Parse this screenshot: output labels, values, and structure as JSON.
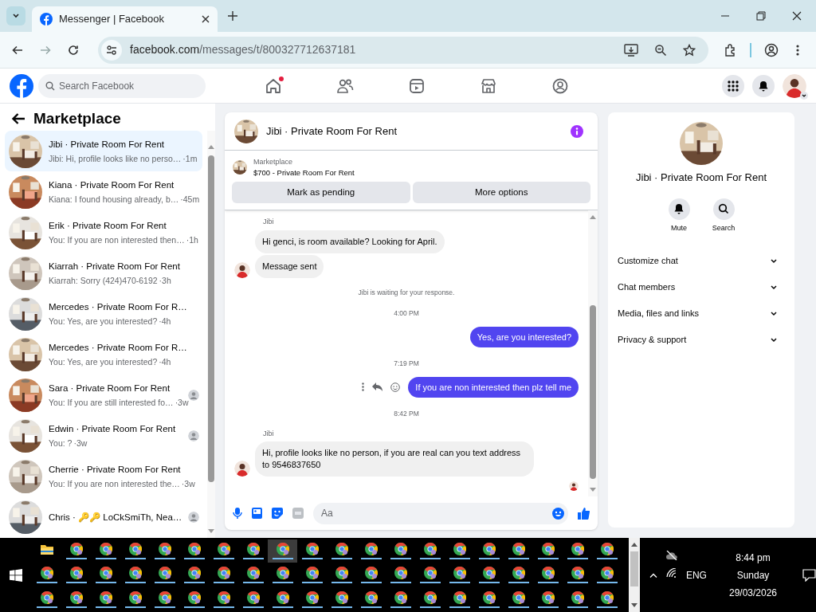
{
  "browser": {
    "tab_title": "Messenger | Facebook",
    "url_host": "facebook.com",
    "url_path": "/messages/t/800327712637181"
  },
  "facebook_header": {
    "search_placeholder": "Search Facebook",
    "nav": [
      {
        "kind": "home",
        "selected": false,
        "dot": true
      },
      {
        "kind": "friends",
        "selected": false,
        "dot": false
      },
      {
        "kind": "video",
        "selected": false,
        "dot": false
      },
      {
        "kind": "marketplace",
        "selected": false,
        "dot": false
      },
      {
        "kind": "gaming",
        "selected": false,
        "dot": false
      }
    ]
  },
  "sidebar": {
    "title": "Marketplace",
    "conversations": [
      {
        "name": "Jibi · Private Room For Rent",
        "preview": "Jibi: Hi, profile looks like no perso…",
        "time": "·1m",
        "selected": true,
        "read_avatar": false
      },
      {
        "name": "Kiana · Private Room For Rent",
        "preview": "Kiana: I found housing already, b…",
        "time": "·45m",
        "selected": false,
        "read_avatar": false
      },
      {
        "name": "Erik · Private Room For Rent",
        "preview": "You: If you are non interested then…",
        "time": "·1h",
        "selected": false,
        "read_avatar": false
      },
      {
        "name": "Kiarrah · Private Room For Rent",
        "preview": "Kiarrah: Sorry (424)470-6192",
        "time": "·3h",
        "selected": false,
        "read_avatar": false
      },
      {
        "name": "Mercedes · Private Room For R…",
        "preview": "You: Yes, are you interested?",
        "time": "·4h",
        "selected": false,
        "read_avatar": false
      },
      {
        "name": "Mercedes · Private Room For R…",
        "preview": "You: Yes, are you interested?",
        "time": "·4h",
        "selected": false,
        "read_avatar": false
      },
      {
        "name": "Sara · Private Room For Rent",
        "preview": "You: If you are still interested fo…",
        "time": "·3w",
        "selected": false,
        "read_avatar": true
      },
      {
        "name": "Edwin · Private Room For Rent",
        "preview": "You: ?",
        "time": "·3w",
        "selected": false,
        "read_avatar": true
      },
      {
        "name": "Cherrie · Private Room For Rent",
        "preview": "You: If you are non interested the…",
        "time": "·3w",
        "selected": false,
        "read_avatar": false
      },
      {
        "name": "Chris · 🔑🔑 LoCkSmiTh, Nea…",
        "selected": false,
        "read_avatar": true
      }
    ]
  },
  "chat": {
    "title": "Jibi · Private Room For Rent",
    "listing": {
      "source": "Marketplace",
      "item": "$700 - Private Room For Rent"
    },
    "buttons": [
      "Mark as pending",
      "More options"
    ],
    "messages": [
      {
        "kind": "sender",
        "text": "Jibi"
      },
      {
        "kind": "incoming",
        "text": "Hi genci, is room available? Looking for April.",
        "avatar": false
      },
      {
        "kind": "incoming",
        "text": "Message sent",
        "avatar": true
      },
      {
        "kind": "notice",
        "text": "Jibi is waiting for your response."
      },
      {
        "kind": "time",
        "text": "4:00 PM"
      },
      {
        "kind": "outgoing",
        "text": "Yes, are you interested?",
        "actions": false
      },
      {
        "kind": "time",
        "text": "7:19 PM"
      },
      {
        "kind": "outgoing",
        "text": "If you are non interested then plz tell me",
        "actions": true
      },
      {
        "kind": "time",
        "text": "8:42 PM"
      },
      {
        "kind": "sender",
        "text": "Jibi"
      },
      {
        "kind": "incoming",
        "text": "Hi, profile looks like no person, if you are real can you text address to 9546837650",
        "avatar": true
      }
    ],
    "composer_placeholder": "Aa"
  },
  "details": {
    "title": "Jibi · Private Room For Rent",
    "actions": [
      {
        "kind": "mute",
        "label": "Mute"
      },
      {
        "kind": "search",
        "label": "Search"
      }
    ],
    "sections": [
      {
        "label": "Customize chat",
        "expanded": false
      },
      {
        "label": "Chat members",
        "expanded": false
      },
      {
        "label": "Media, files and links",
        "expanded": false
      },
      {
        "label": "Privacy & support",
        "expanded": false
      }
    ]
  },
  "taskbar": {
    "app_rows": [
      [
        {
          "kind": "folder",
          "selected": false
        },
        {
          "kind": "chrome",
          "selected": false
        },
        {
          "kind": "chrome",
          "selected": false
        },
        {
          "kind": "chrome",
          "selected": false
        },
        {
          "kind": "chrome",
          "selected": false
        },
        {
          "kind": "chrome",
          "selected": false
        },
        {
          "kind": "chrome",
          "selected": false
        },
        {
          "kind": "chrome",
          "selected": false
        },
        {
          "kind": "chrome",
          "selected": true
        },
        {
          "kind": "chrome",
          "selected": false
        },
        {
          "kind": "chrome",
          "selected": false
        },
        {
          "kind": "chrome",
          "selected": false
        },
        {
          "kind": "chrome",
          "selected": false
        },
        {
          "kind": "chrome",
          "selected": false
        },
        {
          "kind": "chrome",
          "selected": false
        },
        {
          "kind": "chrome",
          "selected": false
        },
        {
          "kind": "chrome",
          "selected": false
        },
        {
          "kind": "chrome",
          "selected": false
        },
        {
          "kind": "chrome",
          "selected": false
        },
        {
          "kind": "chrome",
          "selected": false
        }
      ],
      [
        {
          "kind": "chrome",
          "selected": false
        },
        {
          "kind": "chrome",
          "selected": false
        },
        {
          "kind": "chrome",
          "selected": false
        },
        {
          "kind": "chrome",
          "selected": false
        },
        {
          "kind": "chrome",
          "selected": false
        },
        {
          "kind": "chrome",
          "selected": false
        },
        {
          "kind": "chrome",
          "selected": false
        },
        {
          "kind": "chrome",
          "selected": false
        },
        {
          "kind": "chrome",
          "selected": false
        },
        {
          "kind": "chrome",
          "selected": false
        },
        {
          "kind": "chrome",
          "selected": false
        },
        {
          "kind": "chrome",
          "selected": false
        },
        {
          "kind": "chrome",
          "selected": false
        },
        {
          "kind": "chrome",
          "selected": false
        },
        {
          "kind": "chrome",
          "selected": false
        },
        {
          "kind": "chrome",
          "selected": false
        },
        {
          "kind": "chrome",
          "selected": false
        },
        {
          "kind": "chrome",
          "selected": false
        },
        {
          "kind": "chrome",
          "selected": false
        },
        {
          "kind": "chrome",
          "selected": false
        }
      ],
      [
        {
          "kind": "chrome",
          "selected": false
        },
        {
          "kind": "chrome",
          "selected": false
        },
        {
          "kind": "chrome",
          "selected": false
        },
        {
          "kind": "chrome",
          "selected": false
        },
        {
          "kind": "chrome",
          "selected": false
        },
        {
          "kind": "chrome",
          "selected": false
        },
        {
          "kind": "chrome",
          "selected": false
        },
        {
          "kind": "chrome",
          "selected": false
        },
        {
          "kind": "chrome",
          "selected": false
        },
        {
          "kind": "chrome",
          "selected": false
        },
        {
          "kind": "chrome",
          "selected": false
        },
        {
          "kind": "chrome",
          "selected": false
        },
        {
          "kind": "chrome",
          "selected": false
        },
        {
          "kind": "chrome",
          "selected": false
        },
        {
          "kind": "chrome",
          "selected": false
        },
        {
          "kind": "chrome",
          "selected": false
        },
        {
          "kind": "chrome",
          "selected": false
        },
        {
          "kind": "chrome",
          "selected": false
        },
        {
          "kind": "chrome",
          "selected": false
        },
        {
          "kind": "chrome",
          "selected": false
        }
      ]
    ],
    "language": "ENG",
    "time": "8:44 pm",
    "day": "Sunday",
    "date": "29/03/2026"
  }
}
